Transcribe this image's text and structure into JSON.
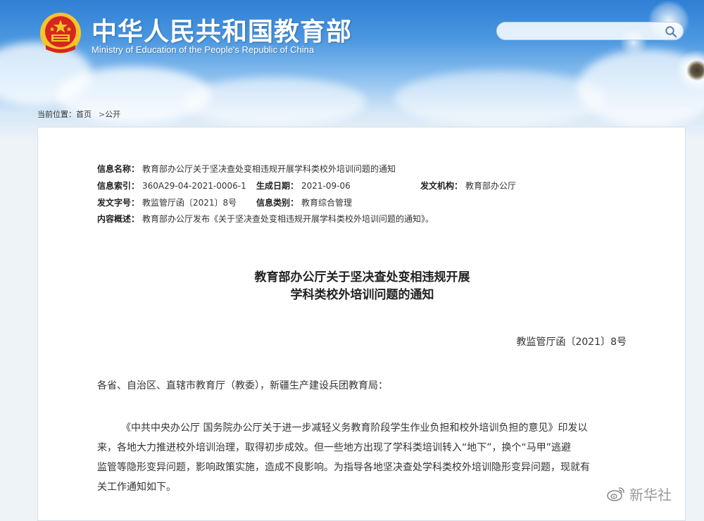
{
  "header": {
    "title": "中华人民共和国教育部",
    "subtitle": "Ministry of Education of the People's Republic of China",
    "search_placeholder": ""
  },
  "breadcrumb": {
    "prefix": "当前位置：",
    "home": "首页",
    "separator": ">",
    "current": "公开"
  },
  "meta": {
    "name_label": "信息名称：",
    "name_value": "教育部办公厅关于坚决查处变相违规开展学科类校外培训问题的通知",
    "index_label": "信息索引：",
    "index_value": "360A29-04-2021-0006-1",
    "date_label": "生成日期：",
    "date_value": "2021-09-06",
    "issuer_label": "发文机构：",
    "issuer_value": "教育部办公厅",
    "docno_label": "发文字号：",
    "docno_value": "教监管厅函〔2021〕8号",
    "category_label": "信息类别：",
    "category_value": "教育综合管理",
    "summary_label": "内容概述：",
    "summary_value": "教育部办公厅发布《关于坚决查处变相违规开展学科类校外培训问题的通知》。"
  },
  "document": {
    "title_line1": "教育部办公厅关于坚决查处变相违规开展",
    "title_line2": "学科类校外培训问题的通知",
    "number": "教监管厅函〔2021〕8号",
    "salutation": "各省、自治区、直辖市教育厅（教委），新疆生产建设兵团教育局：",
    "paragraph_lines": [
      "《中共中央办公厅 国务院办公厅关于进一步减轻义务教育阶段学生作业负担和校外培训负担的意见》印发以",
      "来，各地大力推进校外培训治理，取得初步成效。但一些地方出现了学科类培训转入“地下”，换个“马甲”逃避",
      "监管等隐形变异问题，影响政策实施，造成不良影响。为指导各地坚决查处学科类校外培训隐形变异问题，现就有",
      "关工作通知如下。"
    ]
  },
  "watermark": {
    "text": "新华社",
    "icon": "weibo-icon"
  },
  "colors": {
    "header_blue": "#2f7fd4",
    "emblem_red": "#d7261e",
    "emblem_gold": "#f4c430"
  }
}
